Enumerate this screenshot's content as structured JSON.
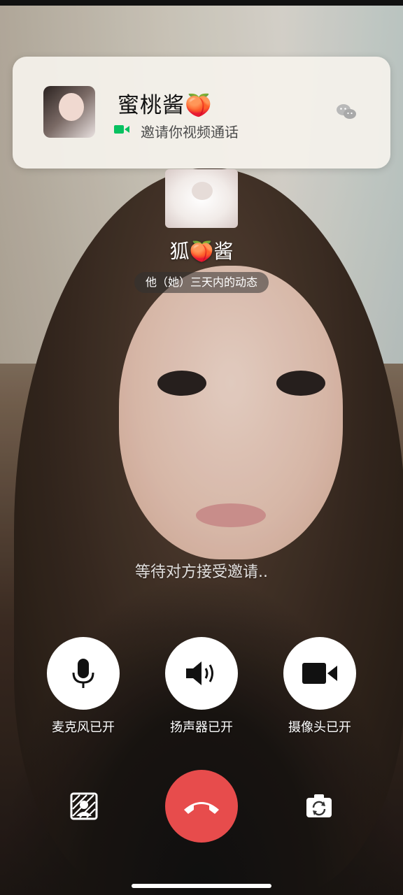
{
  "notification": {
    "caller_name": "蜜桃酱🍑",
    "message": "邀请你视频通话",
    "icons": {
      "avatar": "caller-avatar",
      "video": "video-icon",
      "app": "wechat-icon"
    },
    "accent_color": "#07C160"
  },
  "callee": {
    "name": "狐🍑酱",
    "moments_link": "他（她）三天内的动态"
  },
  "status": {
    "waiting": "等待对方接受邀请.."
  },
  "controls": {
    "mic_label": "麦克风已开",
    "speaker_label": "扬声器已开",
    "camera_label": "摄像头已开"
  },
  "colors": {
    "hangup": "#E74C4C",
    "button_bg": "#FFFFFF"
  }
}
